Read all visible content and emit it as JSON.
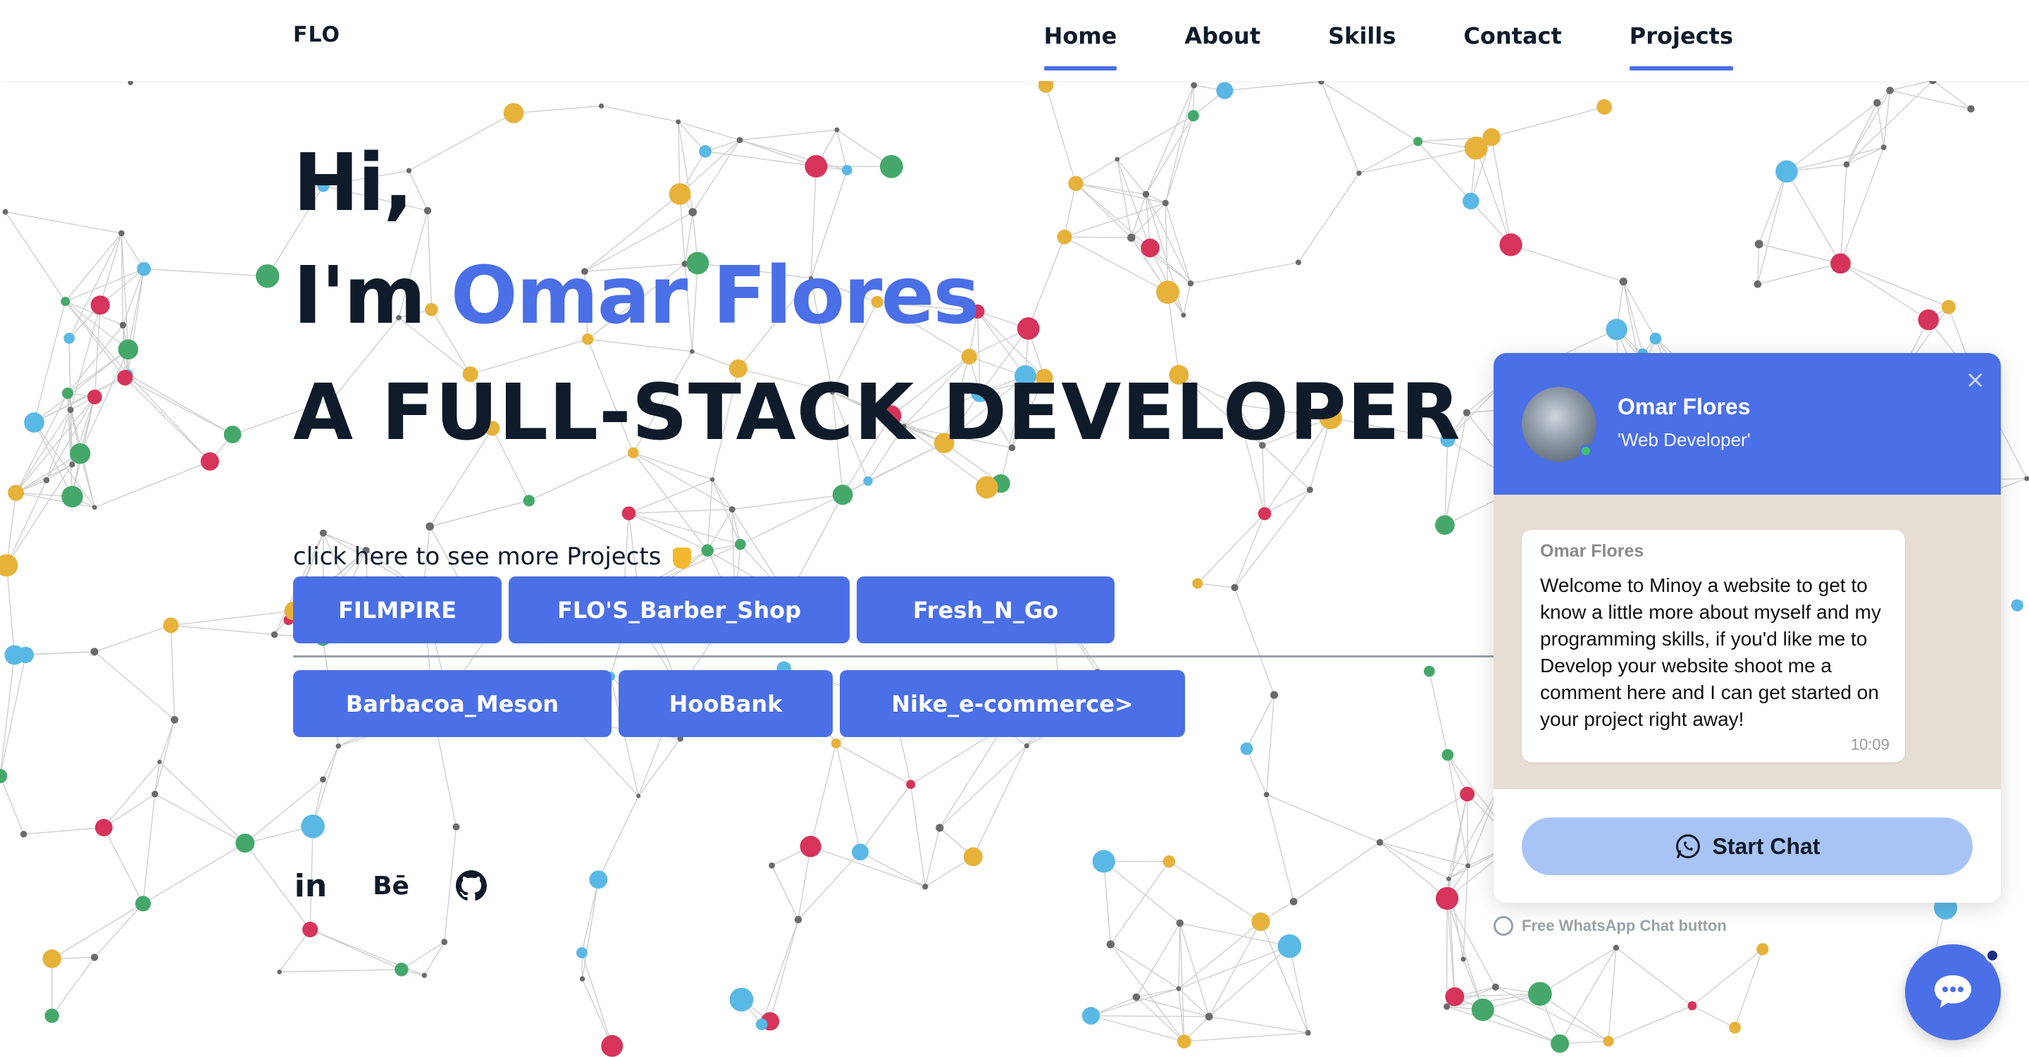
{
  "nav": {
    "logo": "FLO",
    "items": [
      {
        "label": "Home",
        "active": true
      },
      {
        "label": "About",
        "active": false
      },
      {
        "label": "Skills",
        "active": false
      },
      {
        "label": "Contact",
        "active": false
      },
      {
        "label": "Projects",
        "active": true
      }
    ]
  },
  "hero": {
    "greeting": "Hi,",
    "im_prefix": "I'm",
    "name": "Omar Flores",
    "role": "A FULL-STACK DEVELOPER"
  },
  "projects": {
    "hint": "click here to see more Projects",
    "row1": [
      "FILMPIRE",
      "FLO'S_Barber_Shop",
      "Fresh_N_Go"
    ],
    "row2": [
      "Barbacoa_Meson",
      "HooBank",
      "Nike_e-commerce>"
    ]
  },
  "socials": {
    "linkedin": "in",
    "behance": "Bē",
    "github": "github-icon"
  },
  "chat": {
    "name": "Omar Flores",
    "role": "'Web Developer'",
    "message_author": "Omar Flores",
    "message": "Welcome to Minoy a website to get to know a little more about myself and my programming skills, if you'd like me to Develop your website shoot me a comment here and I can get started on your project right away!",
    "time": "10:09",
    "start_button": "Start Chat",
    "powered_by": "Free WhatsApp Chat button",
    "close": "×"
  },
  "colors": {
    "accent": "#4b6fe6",
    "dark": "#0f1b2a",
    "chat_bg": "#e6ded5",
    "start_chat_bg": "#a8c4f7"
  }
}
